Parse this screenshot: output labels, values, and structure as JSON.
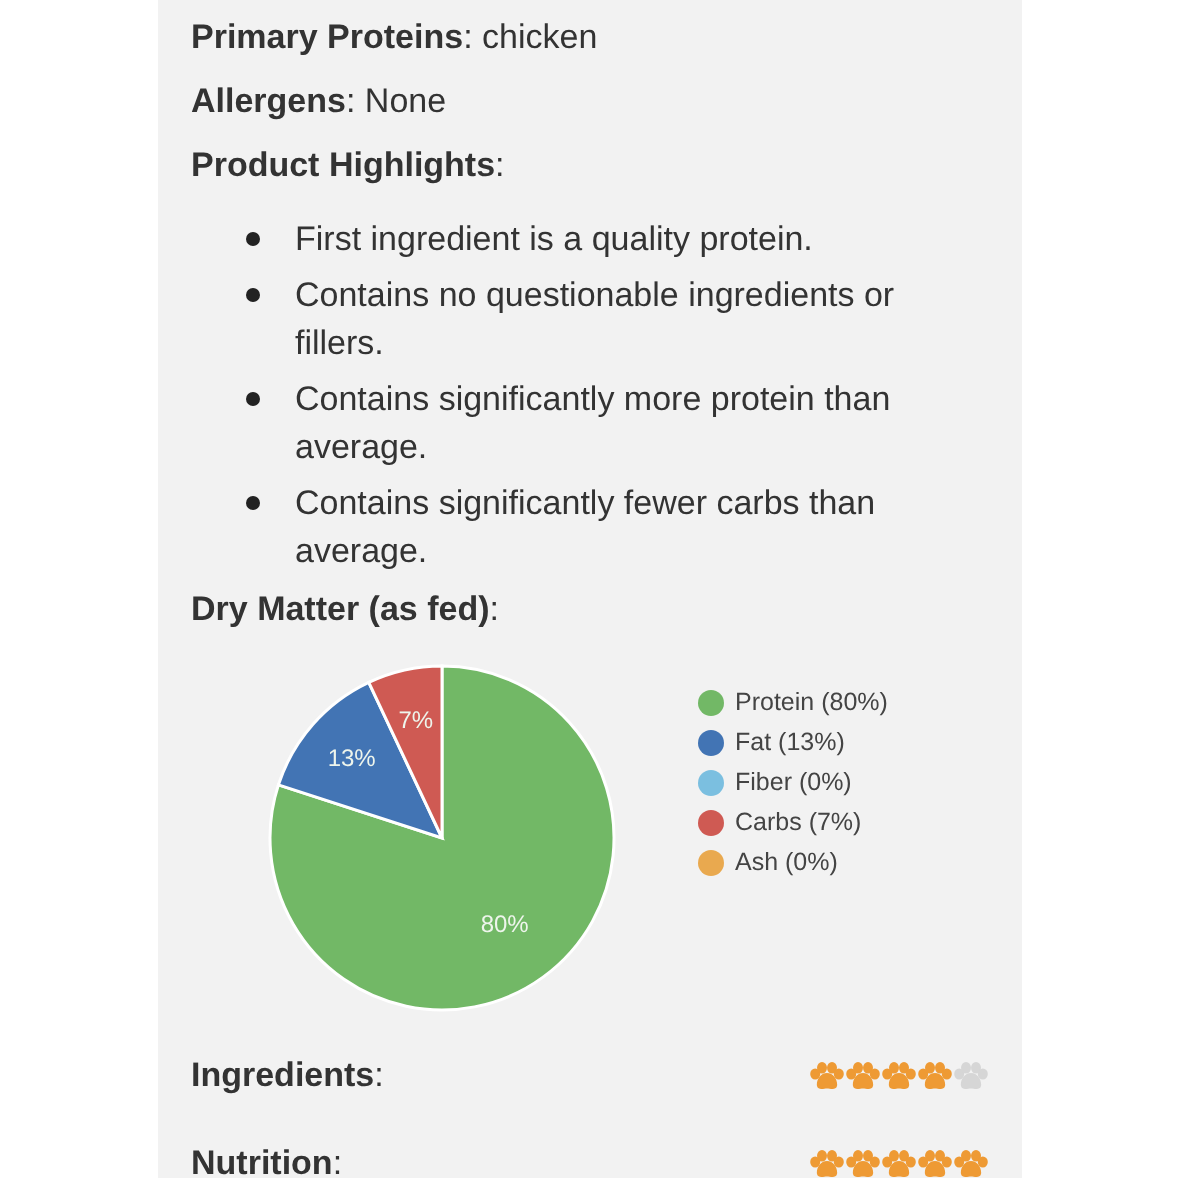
{
  "details": [
    {
      "text": "**Primary Proteins**: chicken"
    },
    {
      "text": "**Allergens**: None"
    }
  ],
  "highlights": {
    "heading": "**Product Highlights**:",
    "items": [
      "First ingredient is a quality protein.",
      "Contains no questionable ingredients or fillers.",
      "Contains significantly more protein than average.",
      "Contains significantly fewer carbs than average."
    ]
  },
  "dry_matter": {
    "heading": "**Dry Matter (as fed)**:",
    "legend": [
      {
        "label": "Protein (80%)",
        "color": "#72b866"
      },
      {
        "label": "Fat (13%)",
        "color": "#4274b4"
      },
      {
        "label": "Fiber (0%)",
        "color": "#7bbfe0"
      },
      {
        "label": "Carbs (7%)",
        "color": "#cf5a53"
      },
      {
        "label": "Ash (0%)",
        "color": "#e9a94f"
      }
    ],
    "chart_data": {
      "type": "pie",
      "values": [
        80,
        13,
        0,
        7,
        0
      ],
      "value_labels": [
        "80%",
        "13%",
        null,
        "7%",
        null
      ]
    }
  },
  "ratings": [
    {
      "label": "**Ingredients**:",
      "stars": 4
    },
    {
      "label": "**Nutrition**:",
      "stars": 5
    }
  ]
}
